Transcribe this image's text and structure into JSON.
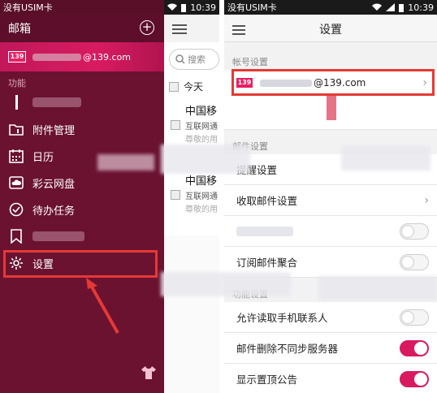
{
  "left": {
    "status": {
      "carrier": "没有USIM卡",
      "time": "10:39"
    },
    "drawer": {
      "title": "邮箱",
      "account_email_suffix": "@139.com",
      "logo_text": "139",
      "section_label": "功能",
      "items": [
        {
          "label": "附件管理",
          "icon": "folder-icon"
        },
        {
          "label": "日历",
          "icon": "calendar-icon"
        },
        {
          "label": "彩云网盘",
          "icon": "cloud-drive-icon"
        },
        {
          "label": "待办任务",
          "icon": "task-check-icon"
        },
        {
          "label": "设置",
          "icon": "gear-icon"
        }
      ]
    },
    "behind": {
      "search_placeholder": "搜索",
      "today_label": "今天",
      "mails": [
        {
          "sender": "中国移",
          "line1": "互联网通",
          "line2": "尊敬的用"
        },
        {
          "sender": "中国移",
          "line1": "互联网通",
          "line2": "尊敬的用"
        }
      ]
    }
  },
  "right": {
    "status": {
      "carrier": "没有USIM卡",
      "time": "10:39"
    },
    "title": "设置",
    "account_section": "帐号设置",
    "account_email_suffix": "@139.com",
    "logo_text": "139",
    "mail_section": "邮件设置",
    "rows_mail": [
      {
        "label": "提醒设置"
      },
      {
        "label": "收取邮件设置"
      },
      {
        "label": ""
      },
      {
        "label": "订阅邮件聚合"
      }
    ],
    "function_section": "功能设置",
    "rows_function": [
      {
        "label": "允许读取手机联系人"
      },
      {
        "label": "邮件删除不同步服务器"
      },
      {
        "label": "显示置顶公告"
      }
    ]
  },
  "colors": {
    "accent": "#d81b60",
    "drawer_bg": "#6b1231",
    "highlight": "#e53935"
  }
}
